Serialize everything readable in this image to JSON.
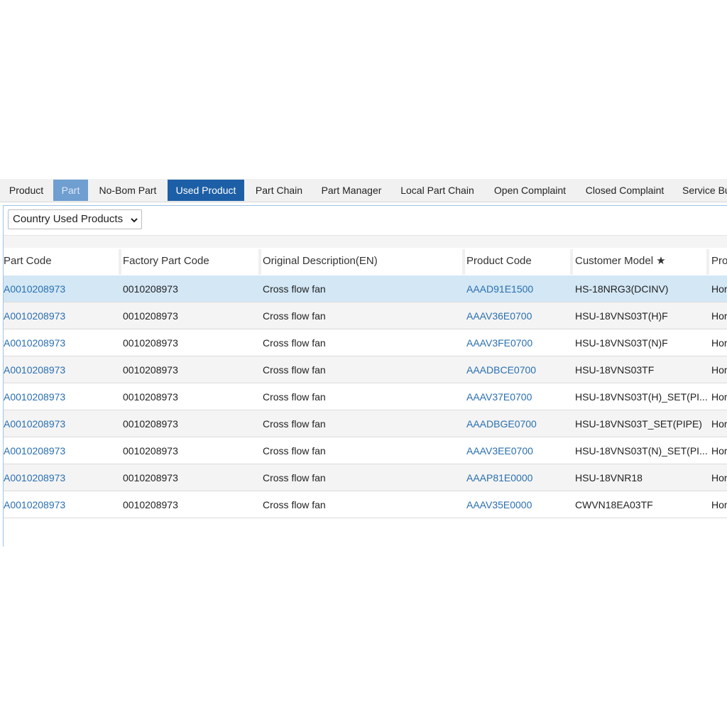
{
  "tabs": [
    {
      "label": "Product",
      "state": "normal"
    },
    {
      "label": "Part",
      "state": "disabled"
    },
    {
      "label": "No-Bom Part",
      "state": "normal"
    },
    {
      "label": "Used Product",
      "state": "active"
    },
    {
      "label": "Part Chain",
      "state": "normal"
    },
    {
      "label": "Part Manager",
      "state": "normal"
    },
    {
      "label": "Local Part Chain",
      "state": "normal"
    },
    {
      "label": "Open Complaint",
      "state": "normal"
    },
    {
      "label": "Closed Complaint",
      "state": "normal"
    },
    {
      "label": "Service Bu",
      "state": "normal"
    }
  ],
  "filter": {
    "selected": "Country Used Products",
    "chevron_icon": "chevron-down-icon"
  },
  "table": {
    "headers": [
      "Part Code",
      "Factory Part Code",
      "Original Description(EN)",
      "Product Code",
      "Customer Model ★",
      "Pro"
    ],
    "rows": [
      [
        "A0010208973",
        "0010208973",
        "Cross flow fan",
        "AAAD91E1500",
        "HS-18NRG3(DCINV)",
        "Hor"
      ],
      [
        "A0010208973",
        "0010208973",
        "Cross flow fan",
        "AAAV36E0700",
        "HSU-18VNS03T(H)F",
        "Hor"
      ],
      [
        "A0010208973",
        "0010208973",
        "Cross flow fan",
        "AAAV3FE0700",
        "HSU-18VNS03T(N)F",
        "Hor"
      ],
      [
        "A0010208973",
        "0010208973",
        "Cross flow fan",
        "AAADBCE0700",
        "HSU-18VNS03TF",
        "Hor"
      ],
      [
        "A0010208973",
        "0010208973",
        "Cross flow fan",
        "AAAV37E0700",
        "HSU-18VNS03T(H)_SET(PI...",
        "Hor"
      ],
      [
        "A0010208973",
        "0010208973",
        "Cross flow fan",
        "AAADBGE0700",
        "HSU-18VNS03T_SET(PIPE)",
        "Hor"
      ],
      [
        "A0010208973",
        "0010208973",
        "Cross flow fan",
        "AAAV3EE0700",
        "HSU-18VNS03T(N)_SET(PI...",
        "Hor"
      ],
      [
        "A0010208973",
        "0010208973",
        "Cross flow fan",
        "AAAP81E0000",
        "HSU-18VNR18",
        "Hor"
      ],
      [
        "A0010208973",
        "0010208973",
        "Cross flow fan",
        "AAAV35E0000",
        "CWVN18EA03TF",
        "Hor"
      ]
    ],
    "selected_row": 0
  },
  "colors": {
    "active_tab": "#1d5fa6",
    "disabled_tab": "#6f9ed0",
    "link": "#2a6fb0",
    "selected_row": "#d3e7f5"
  }
}
